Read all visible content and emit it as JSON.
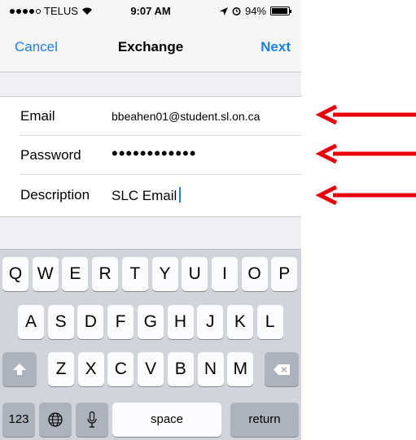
{
  "status_bar": {
    "carrier": "TELUS",
    "time": "9:07 AM",
    "battery": "94%",
    "battery_level": 0.94
  },
  "nav": {
    "cancel": "Cancel",
    "title": "Exchange",
    "next": "Next"
  },
  "form": {
    "email_label": "Email",
    "email_value": "bbeahen01@student.sl.on.ca",
    "password_label": "Password",
    "password_value": "••••••••••••",
    "description_label": "Description",
    "description_value": "SLC Email"
  },
  "keyboard": {
    "row1": [
      "Q",
      "W",
      "E",
      "R",
      "T",
      "Y",
      "U",
      "I",
      "O",
      "P"
    ],
    "row2": [
      "A",
      "S",
      "D",
      "F",
      "G",
      "H",
      "J",
      "K",
      "L"
    ],
    "row3": [
      "Z",
      "X",
      "C",
      "V",
      "B",
      "N",
      "M"
    ],
    "numbers_key": "123",
    "space_key": "space",
    "return_key": "return"
  },
  "annotations": {
    "arrow_color": "#e8000b"
  },
  "colors": {
    "ios_blue": "#1a7ef6"
  }
}
